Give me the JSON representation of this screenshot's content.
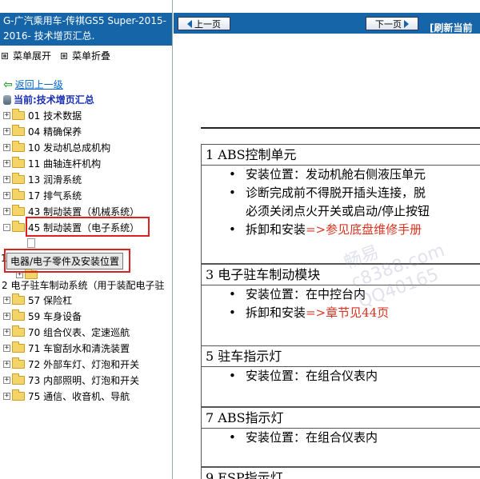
{
  "left": {
    "title": "G-广汽乘用车-传祺GS5 Super-2015-2016- 技术增页汇总.",
    "menu_expand": "菜单展开",
    "menu_collapse": "菜单折叠",
    "back_link": "返回上一级",
    "current": "当前:技术增页汇总",
    "tree": [
      {
        "label": "01 技术数据",
        "sign": "+"
      },
      {
        "label": "04 精确保养",
        "sign": "+"
      },
      {
        "label": "10 发动机总成机构",
        "sign": "+"
      },
      {
        "label": "11 曲轴连杆机构",
        "sign": "+"
      },
      {
        "label": "13 润滑系统",
        "sign": "+"
      },
      {
        "label": "17 排气系统",
        "sign": "+"
      },
      {
        "label": "43 制动装置（机械系统）",
        "sign": "+"
      },
      {
        "label": "45 制动装置（电子系统）",
        "sign": "-"
      }
    ],
    "tooltip": "电器/电子零件及安装位置",
    "side_label_1": "1",
    "subitem_2": "2 电子驻车制动系统（用于装配电子驻",
    "tree2": [
      {
        "label": "57 保险杠",
        "sign": "+"
      },
      {
        "label": "59 车身设备",
        "sign": "+"
      },
      {
        "label": "70 组合仪表、定速巡航",
        "sign": "+"
      },
      {
        "label": "71 车窗刮水和清洗装置",
        "sign": "+"
      },
      {
        "label": "72 外部车灯、灯泡和开关",
        "sign": "+"
      },
      {
        "label": "73 内部照明、灯泡和开关",
        "sign": "+"
      },
      {
        "label": "75 通信、收音机、导航",
        "sign": "+"
      }
    ]
  },
  "right": {
    "prev_label": "上一页",
    "next_label": "下一页",
    "refresh_label": "[刷新当前",
    "sections": [
      {
        "title": "1  ABS控制单元",
        "items": [
          {
            "text": "安装位置：发动机舱右侧液压单元",
            "ref": ""
          },
          {
            "text": "诊断完成前不得脱开插头连接，脱",
            "ref": ""
          },
          {
            "text": "必须关闭点火开关或启动/停止按钮",
            "ref": "",
            "cont": true
          },
          {
            "text": "拆卸和安装",
            "ref": "=>参见底盘维修手册"
          }
        ]
      },
      {
        "title": "3  电子驻车制动模块",
        "items": [
          {
            "text": "安装位置：在中控台内",
            "ref": ""
          },
          {
            "text": "拆卸和安装",
            "ref": "=>章节见44页"
          }
        ]
      },
      {
        "title": "5  驻车指示灯",
        "items": [
          {
            "text": "安装位置：在组合仪表内",
            "ref": ""
          }
        ]
      },
      {
        "title": "7  ABS指示灯",
        "items": [
          {
            "text": "安装位置：在组合仪表内",
            "ref": ""
          }
        ]
      },
      {
        "title": "9  ESP指示灯",
        "items": []
      }
    ],
    "watermark_1": "畅易",
    "watermark_2": "c8388.com",
    "watermark_3": "QQ40165"
  }
}
